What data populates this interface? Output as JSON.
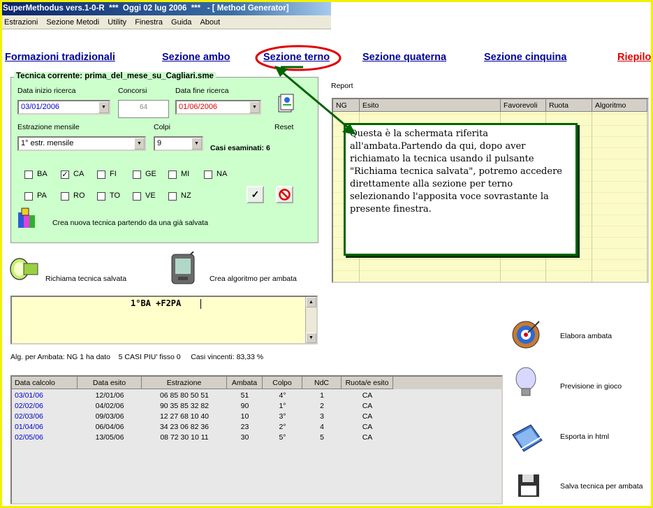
{
  "window": {
    "title": "SuperMethodus vers.1-0-R  ***  Oggi 02 lug 2006  ***   - [ Method Generator]"
  },
  "menu": [
    "Estrazioni",
    "Sezione Metodi",
    "Utility",
    "Finestra",
    "Guida",
    "About"
  ],
  "nav": {
    "tradizionali": "Formazioni tradizionali",
    "ambo": "Sezione ambo",
    "terno": "Sezione terno",
    "quaterna": "Sezione quaterna",
    "cinquina": "Sezione cinquina",
    "riepilogo": "Riepilo"
  },
  "tecnica": {
    "legend": "Tecnica corrente: prima_del_mese_su_Cagliari.sme",
    "data_inizio_label": "Data inizio ricerca",
    "data_inizio_value": "03/01/2006",
    "concorsi_label": "Concorsi",
    "concorsi_value": "64",
    "data_fine_label": "Data fine ricerca",
    "data_fine_value": "01/06/2006",
    "estrazione_label": "Estrazione mensile",
    "estrazione_value": "1° estr. mensile",
    "colpi_label": "Colpi",
    "colpi_value": "9",
    "reset_label": "Reset",
    "casi_esaminati": "Casi esaminati: 6",
    "ruote_row1": [
      {
        "name": "BA",
        "checked": false
      },
      {
        "name": "CA",
        "checked": true
      },
      {
        "name": "FI",
        "checked": false
      },
      {
        "name": "GE",
        "checked": false
      },
      {
        "name": "MI",
        "checked": false
      },
      {
        "name": "NA",
        "checked": false
      }
    ],
    "ruote_row2": [
      {
        "name": "PA",
        "checked": false
      },
      {
        "name": "RO",
        "checked": false
      },
      {
        "name": "TO",
        "checked": false
      },
      {
        "name": "VE",
        "checked": false
      },
      {
        "name": "NZ",
        "checked": false
      }
    ],
    "crea_nuova_label": "Crea nuova tecnica partendo da una già salvata"
  },
  "buttons": {
    "richiama": "Richiama tecnica salvata",
    "crea_algoritmo": "Crea algoritmo per ambata"
  },
  "editor_text": "1°BA +F2PA",
  "status_line": "Alg. per Ambata: NG 1 ha dato    5 CASI PIU' fisso 0     Casi vincenti: 83,33 %",
  "report": {
    "label": "Report",
    "columns": [
      "NG",
      "Esito",
      "Favorevoli",
      "Ruota",
      "Algoritmo"
    ]
  },
  "callout_text": "Questa è la schermata riferita all'ambata.Partendo da qui, dopo aver richiamato la tecnica usando il pulsante \"Richiama tecnica salvata\", potremo accedere direttamente alla sezione per terno selezionando l'apposita voce sovrastante la presente finestra.",
  "results": {
    "columns": [
      "Data calcolo",
      "Data esito",
      "Estrazione",
      "Ambata",
      "Colpo",
      "NdC",
      "Ruota/e esito"
    ],
    "rows": [
      [
        "03/01/06",
        "12/01/06",
        "06 85 80 50 51",
        "51",
        "4°",
        "1",
        "CA"
      ],
      [
        "02/02/06",
        "04/02/06",
        "90 35 85 32 82",
        "90",
        "1°",
        "2",
        "CA"
      ],
      [
        "02/03/06",
        "09/03/06",
        "12 27 68 10 40",
        "10",
        "3°",
        "3",
        "CA"
      ],
      [
        "01/04/06",
        "06/04/06",
        "34 23 06 82 36",
        "23",
        "2°",
        "4",
        "CA"
      ],
      [
        "02/05/06",
        "13/05/06",
        "08 72 30 10 11",
        "30",
        "5°",
        "5",
        "CA"
      ]
    ]
  },
  "side": {
    "elabora": "Elabora ambata",
    "previsione": "Previsione in gioco",
    "esporta": "Esporta in html",
    "salva": "Salva tecnica per ambata"
  },
  "colors": {
    "accent_green": "#006400",
    "highlight_red": "#e00000",
    "nav_blue": "#000099",
    "panel_green": "#ccffcc"
  }
}
